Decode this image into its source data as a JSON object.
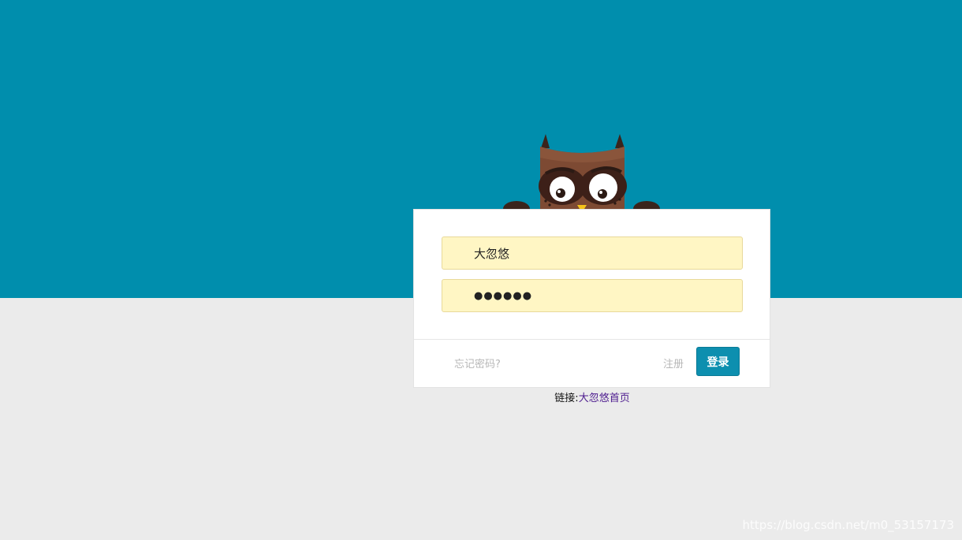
{
  "login": {
    "username_value": "大忽悠",
    "password_value": "●●●●●●",
    "forgot_password": "忘记密码?",
    "register": "注册",
    "login_button": "登录"
  },
  "footer": {
    "prefix": "链接:",
    "link_text": "大忽悠首页"
  },
  "watermark": "https://blog.csdn.net/m0_53157173",
  "colors": {
    "background_band": "#008ead",
    "page_background": "#ebebeb",
    "input_fill": "#fff6c4",
    "primary_button": "#0d8faf"
  },
  "icons": {
    "mascot": "owl-icon"
  }
}
